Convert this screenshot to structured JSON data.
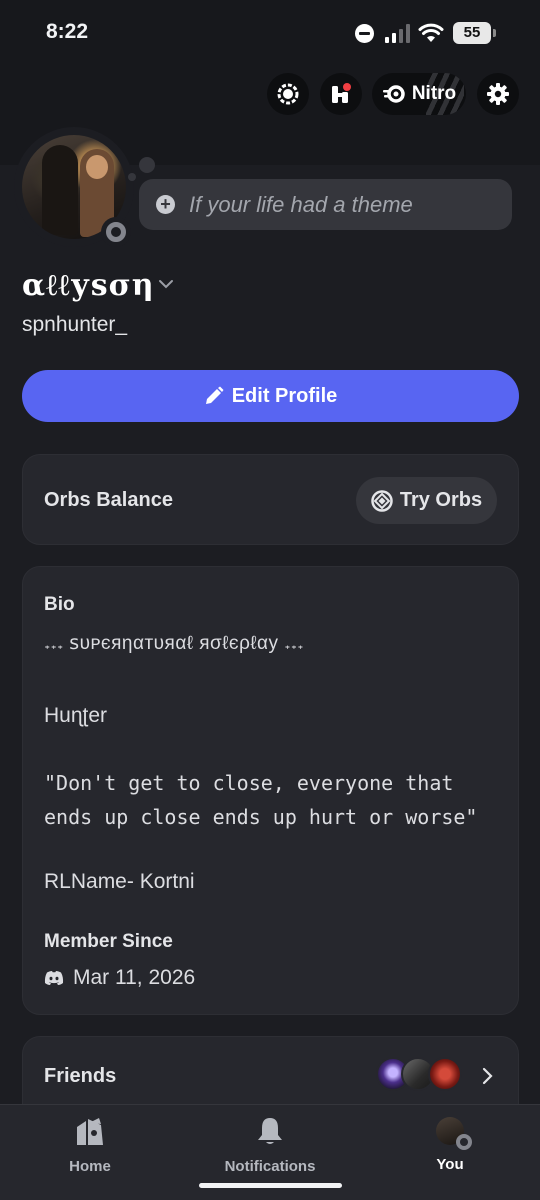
{
  "status_bar": {
    "time": "8:22",
    "battery": "55"
  },
  "header": {
    "nitro_label": "Nitro"
  },
  "profile": {
    "custom_status_placeholder": "If your life had a theme",
    "display_name": "αℓℓуѕση",
    "username": "spnhunter_",
    "edit_profile_label": "Edit Profile"
  },
  "orbs": {
    "title": "Orbs Balance",
    "button_label": "Try Orbs"
  },
  "bio": {
    "title": "Bio",
    "line1": "𝅄𝅄𝅄 ꜱᴜᴘєяηαтυяαℓ яσℓєρℓαу 𝅄𝅄𝅄",
    "line2": "Huɳʈer",
    "quote": "\"Don't get to close, everyone that ends up close ends up hurt or worse\"",
    "rlname": "RLName- Kortni",
    "member_since_title": "Member Since",
    "member_since_date": "Mar 11, 2026"
  },
  "friends": {
    "title": "Friends"
  },
  "nav": {
    "home": "Home",
    "notifications": "Notifications",
    "you": "You"
  },
  "colors": {
    "accent": "#5865f2",
    "background": "#1c1d22",
    "card": "#26272d",
    "status_offline": "#83858d"
  },
  "icons": [
    "shop-icon",
    "quests-icon",
    "nitro-icon",
    "settings-icon",
    "plus-icon",
    "chevron-down-icon",
    "pencil-icon",
    "orb-icon",
    "discord-icon",
    "chevron-right-icon",
    "home-icon",
    "bell-icon"
  ]
}
